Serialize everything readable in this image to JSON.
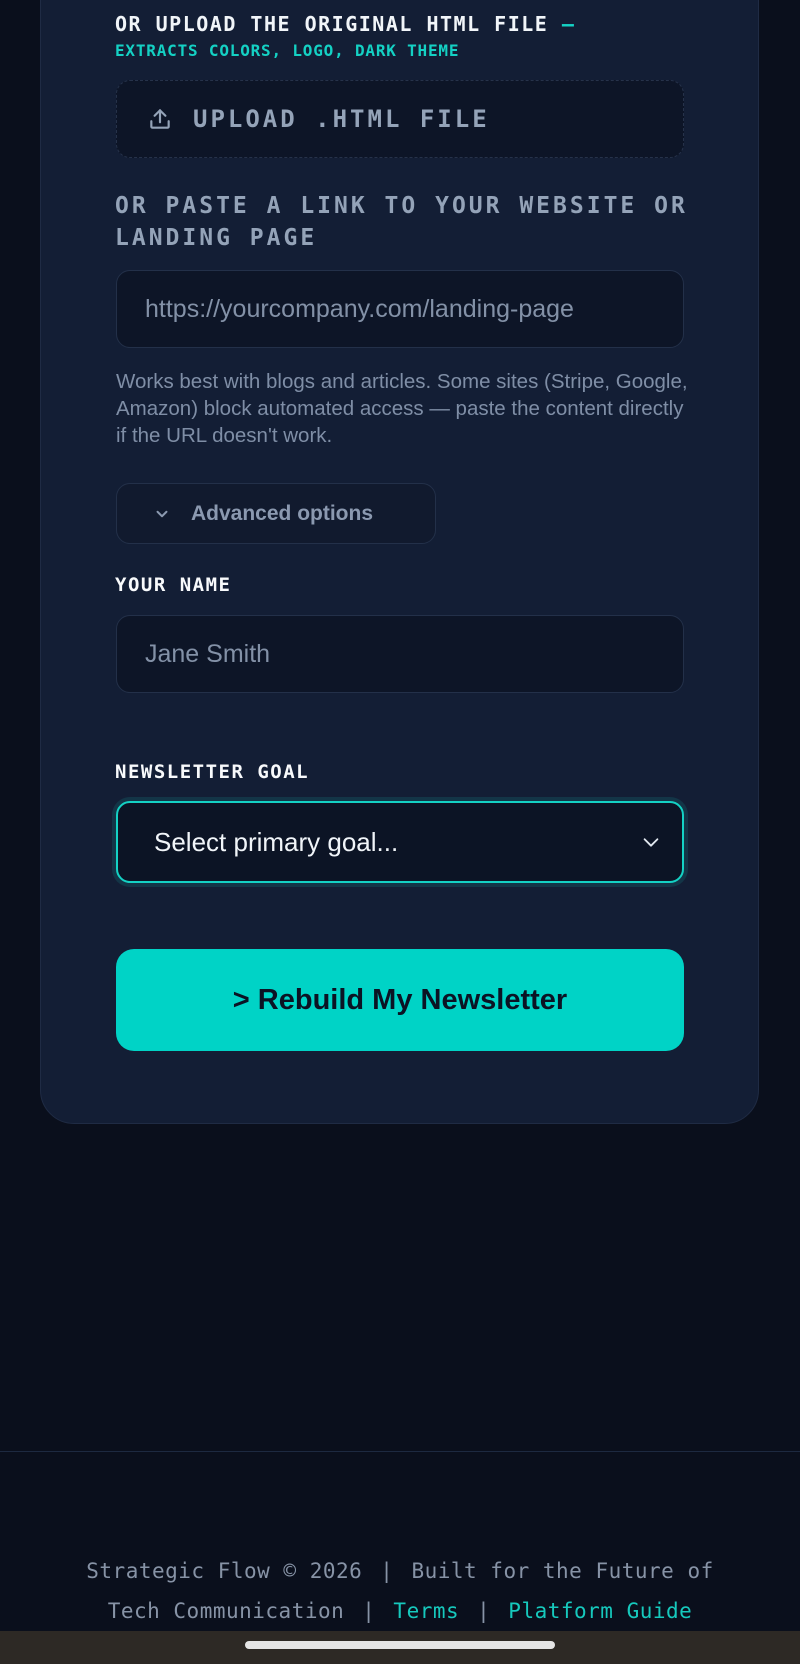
{
  "upload": {
    "label": "OR UPLOAD THE ORIGINAL HTML FILE",
    "label_accent": "—",
    "sublabel": "EXTRACTS COLORS, LOGO, DARK THEME",
    "button_label": "UPLOAD .HTML FILE",
    "icon": "upload-icon"
  },
  "link": {
    "label": "OR PASTE A LINK TO YOUR WEBSITE OR LANDING PAGE",
    "placeholder": "https://yourcompany.com/landing-page",
    "hint": "Works best with blogs and articles. Some sites (Stripe, Google, Amazon) block automated access — paste the content directly if the URL doesn't work."
  },
  "advanced": {
    "label": "Advanced options",
    "icon": "chevron-down-icon"
  },
  "name_field": {
    "label": "YOUR NAME",
    "placeholder": "Jane Smith"
  },
  "goal_field": {
    "label": "NEWSLETTER GOAL",
    "selected": "Select primary goal...",
    "icon": "chevron-down-icon"
  },
  "cta": {
    "label": "> Rebuild My Newsletter"
  },
  "footer": {
    "text_1": "Strategic Flow © 2026",
    "separator": "|",
    "text_2": "Built for the Future of",
    "text_3": "Tech Communication",
    "terms_link": "Terms",
    "guide_link": "Platform Guide"
  },
  "colors": {
    "background": "#0a0f1c",
    "card": "#131e35",
    "accent": "#14d1c4",
    "cta": "#00d3c6"
  }
}
